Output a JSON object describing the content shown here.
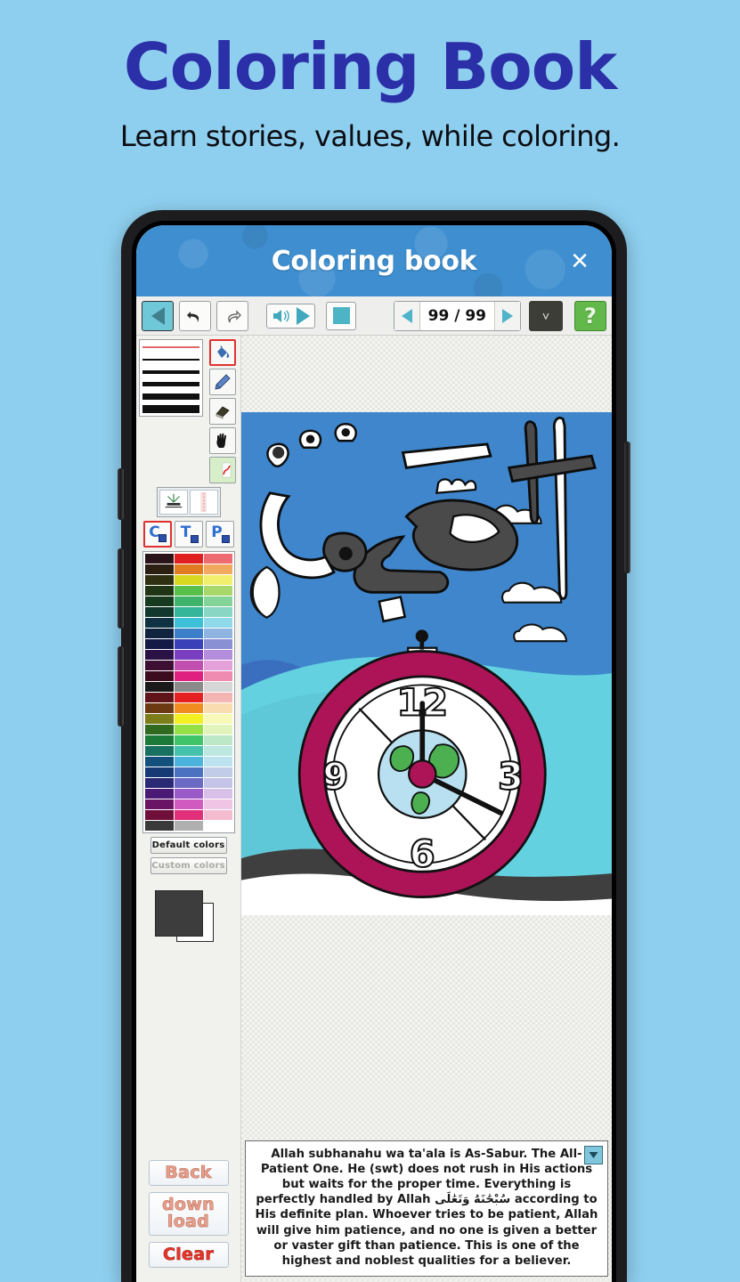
{
  "hero": {
    "title": "Coloring Book",
    "subtitle": "Learn stories, values, while coloring.",
    "title_color": "#2b2fa8",
    "background_color": "#8ecfef"
  },
  "app": {
    "title": "Coloring book",
    "close_label": "×",
    "titlebar_color": "#3f8fd0"
  },
  "toolbar": {
    "back_label": "◀",
    "undo_label": "↶",
    "redo_label": "↷",
    "play_sound_label": "▶",
    "stop_label": "■",
    "prev_page_label": "◀",
    "next_page_label": "▶",
    "page_counter": "99 / 99",
    "dropdown_label": "˅",
    "help_label": "?"
  },
  "tools": {
    "brush_sizes": [
      1,
      2,
      4,
      5,
      7,
      8
    ],
    "items": [
      {
        "name": "fill",
        "selected": true
      },
      {
        "name": "pencil",
        "selected": false
      },
      {
        "name": "eraser",
        "selected": false
      },
      {
        "name": "hand",
        "selected": false
      },
      {
        "name": "curve",
        "selected": false
      }
    ],
    "ctp": [
      {
        "letter": "C",
        "selected": true
      },
      {
        "letter": "T",
        "selected": false
      },
      {
        "letter": "P",
        "selected": false
      }
    ],
    "palette_default_label": "Default colors",
    "palette_custom_label": "Custom colors",
    "foreground_color": "#3d3d3d",
    "background_color": "#ffffff",
    "palette_colors": [
      "#2b1419",
      "#e02020",
      "#ef6b72",
      "#2a1f10",
      "#e07b20",
      "#f0a95e",
      "#2f2f12",
      "#d8d820",
      "#f3ef6e",
      "#1f3514",
      "#57c04a",
      "#a9d86a",
      "#153a1e",
      "#3fb36a",
      "#84d49a",
      "#12372c",
      "#35b59a",
      "#8ad6c4",
      "#0f3242",
      "#3cc0d8",
      "#8fd9ea",
      "#10243f",
      "#3a7fc8",
      "#8fb4e2",
      "#131a46",
      "#3a41b8",
      "#8a90d4",
      "#2a1246",
      "#7a3fc0",
      "#b48ddc",
      "#3c0f33",
      "#c14fb0",
      "#e4a0d8",
      "#3c0c1e",
      "#e02080",
      "#ef8ab0",
      "#1a1a1a",
      "#8a8a8a",
      "#d6d6d6",
      "#5e1418",
      "#e42020",
      "#f4b4b4",
      "#6b3a12",
      "#f08c20",
      "#f9dcb0",
      "#7d7d1a",
      "#f2f020",
      "#f8f8b8",
      "#2f6a1e",
      "#95e044",
      "#e0f4bc",
      "#1b7a38",
      "#3fc46a",
      "#bce8c8",
      "#187060",
      "#44c2ac",
      "#bce8e0",
      "#14507c",
      "#4ab4dc",
      "#bce2f0",
      "#163a74",
      "#4a72c0",
      "#c0cce8",
      "#2a2a74",
      "#6a6ac4",
      "#c4c4e8",
      "#4a1a74",
      "#9a5ac8",
      "#d8c0e8",
      "#6a1466",
      "#d05ac0",
      "#f0c4e4",
      "#70103a",
      "#e0307a",
      "#f4bcd0",
      "#3a3a3a",
      "#b0b0b0",
      "#ffffff"
    ]
  },
  "actions": {
    "back_label": "Back",
    "download_label_line1": "down",
    "download_label_line2": "load",
    "clear_label": "Clear"
  },
  "artwork": {
    "arabic_name": "الصبور",
    "sky_color": "#3f86cc",
    "ground_color": "#63d1e0",
    "clock_ring_color": "#ad1457",
    "clock_face_color": "#ffffff",
    "globe_color": "#b8e0f0",
    "land_color": "#4caf50",
    "clock_numbers": [
      "12",
      "3",
      "6",
      "9"
    ]
  },
  "caption": {
    "text": "Allah subhanahu wa ta'ala is As-Sabur. The All-Patient One. He (swt) does not rush in His actions but waits for the proper time. Everything is perfectly handled by Allah سُبْحَٰنَهُ وَتَعَٰلَى according to His definite plan. Whoever tries to be patient, Allah will give him patience, and no one is given a better or vaster gift than patience. This is one of the highest and noblest qualities for a believer.",
    "scroll_label": "▼"
  }
}
